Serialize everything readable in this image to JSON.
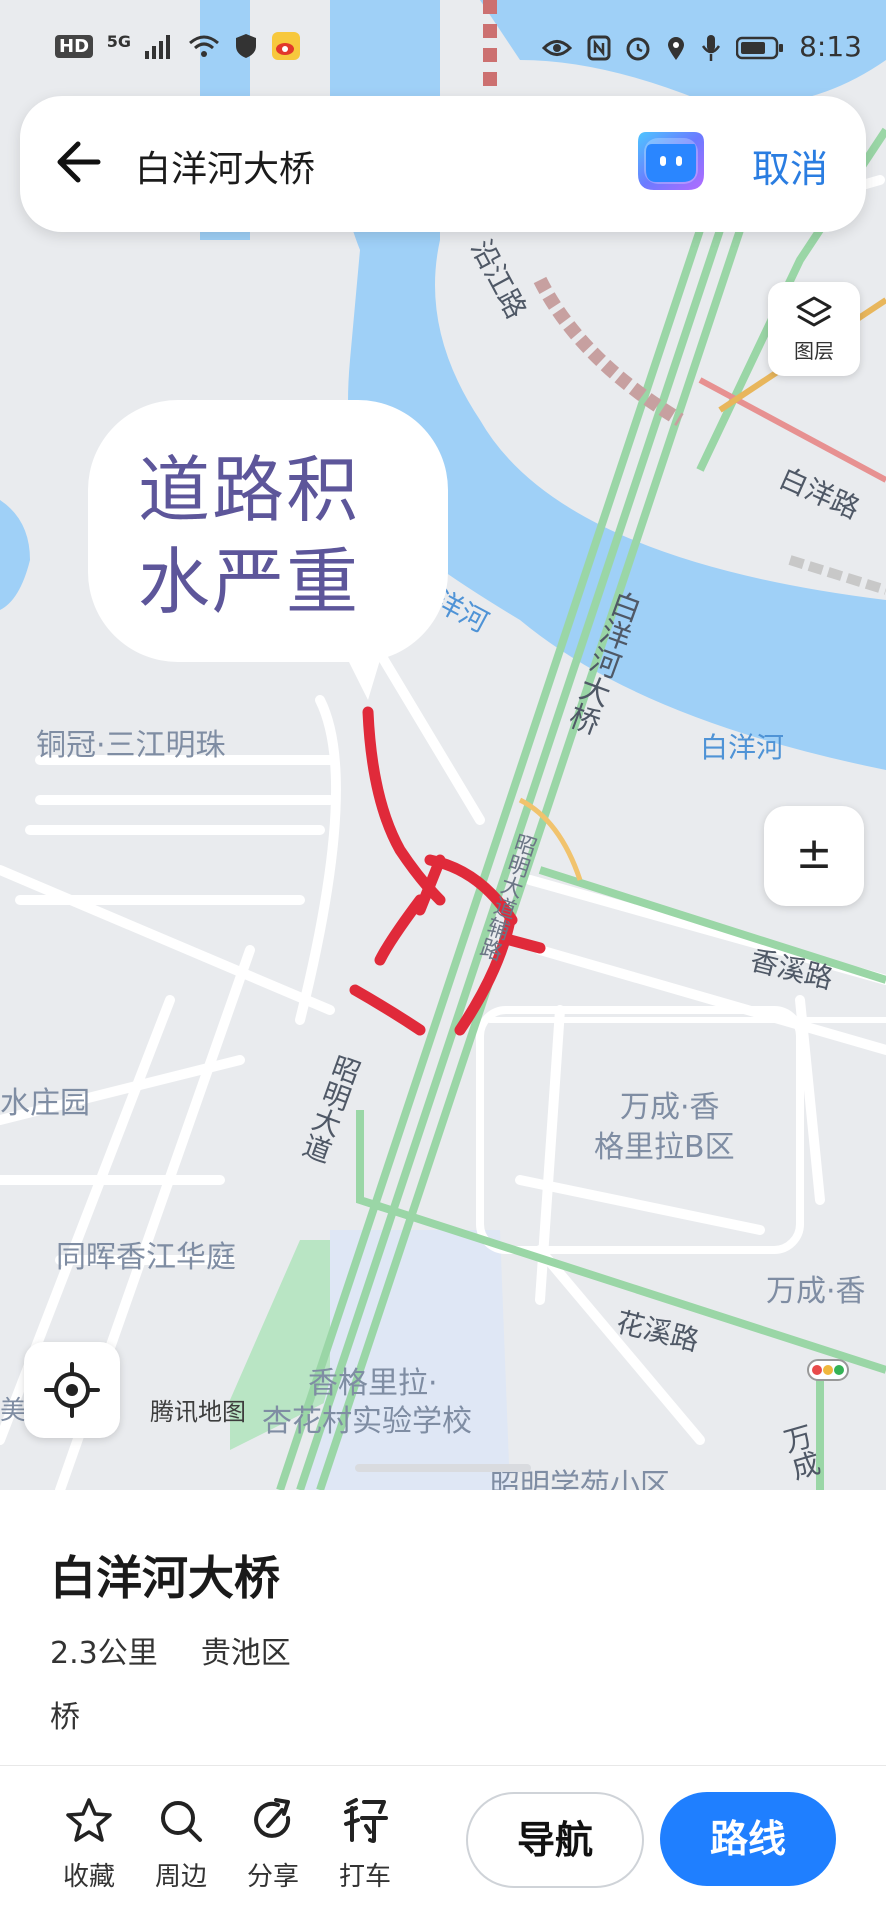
{
  "status_bar": {
    "left_badges": [
      "HD",
      "5G"
    ],
    "time": "8:13"
  },
  "search": {
    "query": "白洋河大桥",
    "cancel_label": "取消"
  },
  "map": {
    "layer_label": "图层",
    "zoom_symbol": "±",
    "provider_logo": "腾讯地图",
    "annotation_text_line1": "道路积",
    "annotation_text_line2": "水严重",
    "labels": {
      "road_top": "沿江路",
      "baiyang_road": "白洋路",
      "baiyang_river_left": "洋河",
      "baiyang_bridge": "白洋河大桥",
      "baiyang_river_right": "白洋河",
      "tongguan": "铜冠·三江明珠",
      "zhaoming_aux": "昭明大道辅路",
      "xiangxi_road": "香溪路",
      "shuizhuang": "水庄园",
      "zhaoming_avenue": "昭明大道",
      "wancheng_b": "万成·香",
      "wancheng_b2": "格里拉B区",
      "tonghui": "同晖香江华庭",
      "wancheng_right": "万成·香",
      "huaxi_road": "花溪路",
      "shangri_school1": "香格里拉·",
      "shangri_school2": "杏花村实验学校",
      "meijia_plaza": "美家广场",
      "zhaoming_xueyuan": "昭明学苑小区",
      "wancheng_vertical": "万成"
    }
  },
  "place": {
    "title": "白洋河大桥",
    "distance": "2.3公里",
    "district": "贵池区",
    "type": "桥"
  },
  "actions": [
    {
      "label": "收藏",
      "icon": "star-icon"
    },
    {
      "label": "周边",
      "icon": "search-icon"
    },
    {
      "label": "分享",
      "icon": "share-icon"
    },
    {
      "label": "打车",
      "icon": "taxi-icon"
    }
  ],
  "buttons": {
    "navigate": "导航",
    "route": "路线"
  },
  "colors": {
    "accent": "#1f7fff",
    "water": "#9fd0f7",
    "road_green": "#9ad6a6",
    "annotation_red": "#e02a3a",
    "annotation_text": "#5d569a"
  }
}
